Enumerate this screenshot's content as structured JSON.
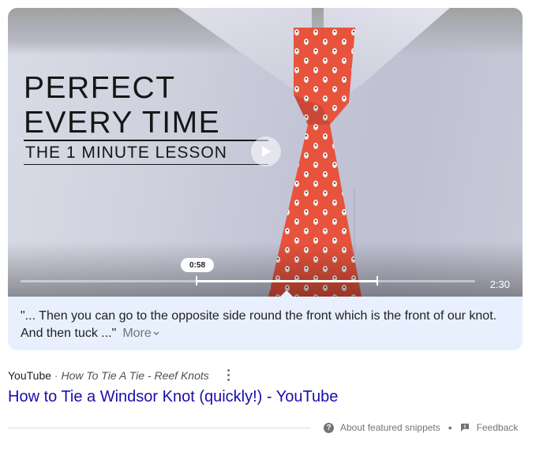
{
  "video": {
    "headline_line1": "PERFECT",
    "headline_line2": "EVERY TIME",
    "subtitle": "THE 1 MINUTE LESSON",
    "current_time": "0:58",
    "duration": "2:30",
    "play_icon": "play-icon",
    "progress_fraction": 0.386,
    "highlight_start_fraction": 0.386,
    "highlight_end_fraction": 0.783
  },
  "snippet": {
    "quote": "\"... Then you can go to the opposite side round the front which is the front of our knot. And then tuck ...\"",
    "more_label": "More",
    "more_icon": "chevron-down-icon"
  },
  "result": {
    "source_site": "YouTube",
    "separator": "·",
    "breadcrumb": "How To Tie A Tie - Reef Knots",
    "menu_icon": "more-vert-icon",
    "title": "How to Tie a Windsor Knot (quickly!) - YouTube"
  },
  "footer": {
    "about_label": "About featured snippets",
    "about_icon": "help-icon",
    "dot": "•",
    "feedback_label": "Feedback",
    "feedback_icon": "feedback-icon"
  },
  "colors": {
    "link": "#1a0dab",
    "snippet_background": "#e8f0fe",
    "tie_red": "#e8533e",
    "muted_text": "#70757a"
  }
}
